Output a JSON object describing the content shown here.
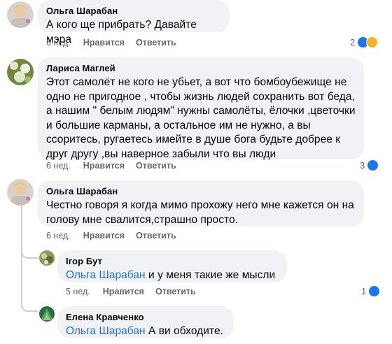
{
  "comments": [
    {
      "author": "Ольга Шарабан",
      "text": "А кого ще прибрать? Давайте мэра",
      "time": "6 нед.",
      "like_label": "Нравится",
      "reply_label": "Ответить",
      "reaction_count": "2",
      "reactions": [
        "like-icon",
        "haha-icon"
      ]
    },
    {
      "author": "Лариса Маглей",
      "text": "Этот самолёт не кого не убьет, а вот что бомбоубежище не одно не пригодное , чтобы жизнь людей сохранить вот беда, а нашим \" белым людям\" нужны самолёты, ёлочки ,цветочки и большие карманы, а остальное им не нужно, а вы ссоритесь, ругаетесь имейте в душе бога  будьте добрее к друг другу ,вы наверное забыли что вы люди",
      "time": "6 нед.",
      "like_label": "Нравится",
      "reply_label": "Ответить",
      "reaction_count": "3",
      "reactions": [
        "like-icon"
      ]
    },
    {
      "author": "Ольга Шарабан",
      "text": "Честно говоря я когда мимо прохожу него мне кажется он на голову мне свалится,страшно просто.",
      "time": "6 нед.",
      "like_label": "Нравится",
      "reply_label": "Ответить"
    }
  ],
  "replies": [
    {
      "author": "Ігор Бут",
      "mention": "Ольга Шарабан",
      "text": " и у меня такие же мысли",
      "time": "5 нед.",
      "like_label": "Нравится",
      "reply_label": "Ответить",
      "reaction_count": "1",
      "reactions": [
        "like-icon"
      ]
    },
    {
      "author": "Елена Кравченко",
      "mention": "Ольга Шарабан",
      "text": " А ви обходите."
    }
  ],
  "colors": {
    "bubble": "#f0f2f5",
    "meta": "#65676b",
    "mention": "#216fdb",
    "like": "#1877f2",
    "haha": "#f7b125"
  }
}
